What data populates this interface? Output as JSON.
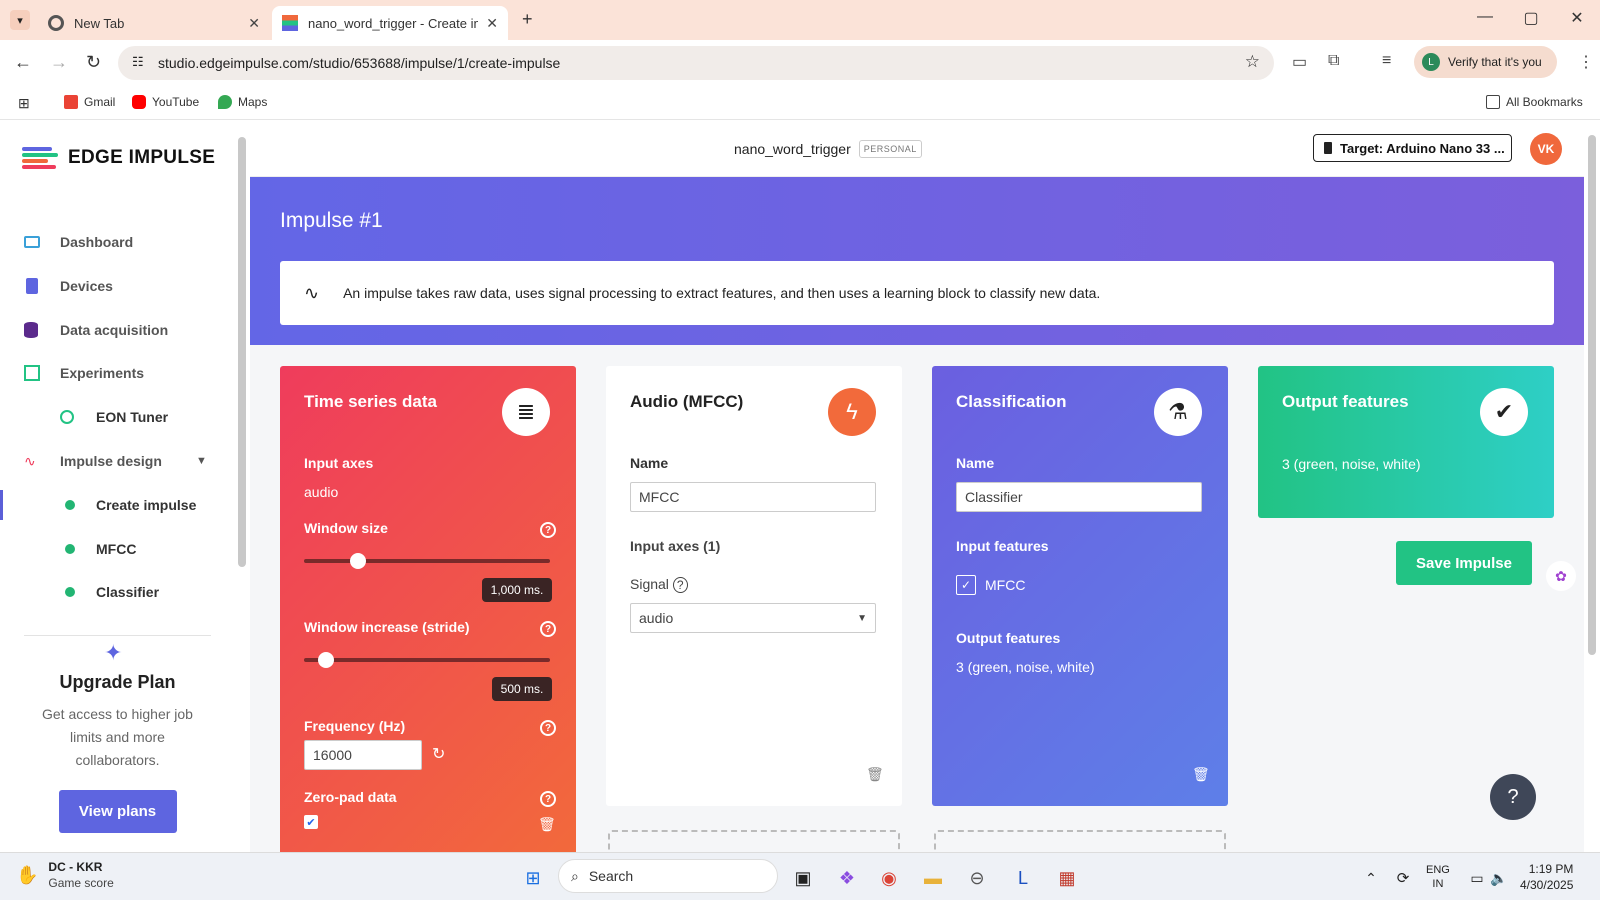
{
  "browser": {
    "tabs": [
      {
        "title": "New Tab"
      },
      {
        "title": "nano_word_trigger - Create imp"
      }
    ],
    "url": "studio.edgeimpulse.com/studio/653688/impulse/1/create-impulse",
    "verify_label": "Verify that it's you",
    "bookmarks": [
      "Gmail",
      "YouTube",
      "Maps"
    ],
    "all_bookmarks": "All Bookmarks"
  },
  "sidebar": {
    "logo": "EDGE IMPULSE",
    "items": [
      {
        "label": "Dashboard",
        "icon": "monitor-icon"
      },
      {
        "label": "Devices",
        "icon": "chip-icon"
      },
      {
        "label": "Data acquisition",
        "icon": "database-icon"
      },
      {
        "label": "Experiments",
        "icon": "grid-icon"
      },
      {
        "label": "EON Tuner",
        "icon": "compass-icon"
      },
      {
        "label": "Impulse design",
        "icon": "pulse-icon"
      },
      {
        "label": "Create impulse"
      },
      {
        "label": "MFCC"
      },
      {
        "label": "Classifier"
      }
    ],
    "upgrade": {
      "title": "Upgrade Plan",
      "line1": "Get access to higher job",
      "line2": "limits and more",
      "line3": "collaborators.",
      "button": "View plans"
    }
  },
  "header": {
    "project": "nano_word_trigger",
    "badge": "PERSONAL",
    "target": "Target: Arduino Nano 33 ...",
    "avatar": "VK"
  },
  "hero": {
    "title": "Impulse #1",
    "info": "An impulse takes raw data, uses signal processing to extract features, and then uses a learning block to classify new data."
  },
  "cards": {
    "timeseries": {
      "title": "Time series data",
      "input_axes_label": "Input axes",
      "input_axes_value": "audio",
      "window_size_label": "Window size",
      "window_size_value": "1,000 ms.",
      "window_size_fraction": 0.2,
      "stride_label": "Window increase (stride)",
      "stride_value": "500 ms.",
      "stride_fraction": 0.06,
      "frequency_label": "Frequency (Hz)",
      "frequency_value": "16000",
      "zeropad_label": "Zero-pad data",
      "zeropad_checked": true
    },
    "mfcc": {
      "title": "Audio (MFCC)",
      "name_label": "Name",
      "name_value": "MFCC",
      "input_axes_label": "Input axes (1)",
      "signal_label": "Signal",
      "signal_value": "audio"
    },
    "classification": {
      "title": "Classification",
      "name_label": "Name",
      "name_value": "Classifier",
      "input_features_label": "Input features",
      "input_feature": "MFCC",
      "output_features_label": "Output features",
      "output_features_value": "3 (green, noise, white)"
    },
    "output": {
      "title": "Output features",
      "value": "3 (green, noise, white)"
    }
  },
  "save_button": "Save Impulse",
  "taskbar": {
    "weather_title": "DC - KKR",
    "weather_sub": "Game score",
    "search": "Search",
    "lang1": "ENG",
    "lang2": "IN",
    "time": "1:19 PM",
    "date": "4/30/2025"
  },
  "colors": {
    "accent": "#5e65e0",
    "timeseries_start": "#ef3c5c",
    "timeseries_end": "#f26a3b",
    "classification": "#6b5fe0",
    "output": "#22c384"
  }
}
